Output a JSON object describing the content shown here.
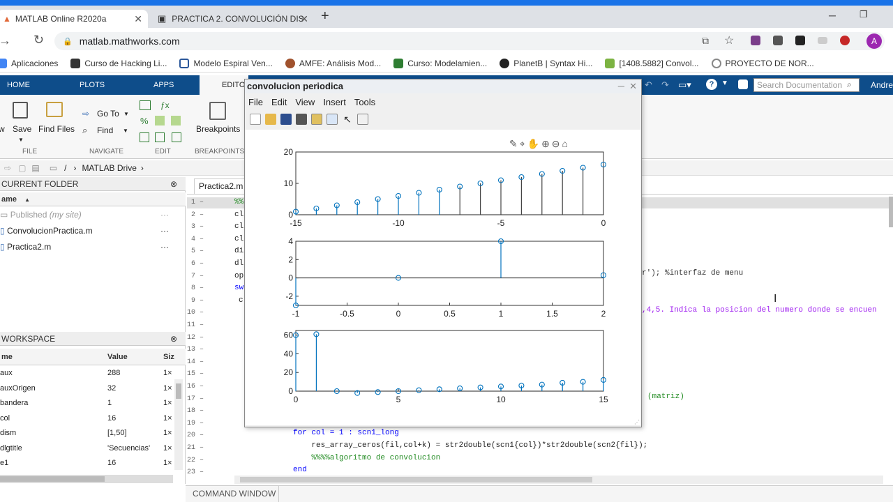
{
  "browser": {
    "tabs": [
      {
        "title": "MATLAB Online R2020a",
        "active": true
      },
      {
        "title": "PRACTICA 2. CONVOLUCIÓN DIS",
        "active": false
      }
    ],
    "new_tab": "+",
    "url": "matlab.mathworks.com",
    "profile_initial": "A",
    "bookmarks": [
      "Aplicaciones",
      "Curso de Hacking Li...",
      "Modelo Espiral Ven...",
      "AMFE: Análisis Mod...",
      "Curso: Modelamien...",
      "PlanetB | Syntax Hi...",
      "[1408.5882] Convol...",
      "PROYECTO DE NOR..."
    ]
  },
  "matlab": {
    "tabs": [
      "HOME",
      "PLOTS",
      "APPS",
      "EDITOR"
    ],
    "search_placeholder": "Search Documentation",
    "user": "Andre",
    "ribbon": {
      "new_short": "w",
      "save": "Save",
      "find_files": "Find Files",
      "goto": "Go To",
      "find": "Find",
      "breakpoints": "Breakpoints",
      "sections": [
        "FILE",
        "NAVIGATE",
        "EDIT",
        "BREAKPOINTS"
      ]
    },
    "path": [
      "/",
      "MATLAB Drive"
    ],
    "current_folder": {
      "title": "CURRENT FOLDER",
      "column": "ame",
      "items": [
        {
          "name": "Published",
          "note": "(my site)"
        },
        {
          "name": "ConvolucionPractica.m",
          "note": ""
        },
        {
          "name": "Practica2.m",
          "note": ""
        }
      ]
    },
    "workspace": {
      "title": "WORKSPACE",
      "columns": [
        "me",
        "Value",
        "Siz"
      ],
      "rows": [
        {
          "name": "aux",
          "value": "288",
          "size": "1×"
        },
        {
          "name": "auxOrigen",
          "value": "32",
          "size": "1×"
        },
        {
          "name": "bandera",
          "value": "1",
          "size": "1×"
        },
        {
          "name": "col",
          "value": "16",
          "size": "1×"
        },
        {
          "name": "dism",
          "value": "[1,50]",
          "size": "1×"
        },
        {
          "name": "dlgtitle",
          "value": "'Secuencias'",
          "size": "1×"
        },
        {
          "name": "e1",
          "value": "16",
          "size": "1×"
        }
      ]
    },
    "editor": {
      "tab": "Practica2.m",
      "line_numbers": [
        "1",
        "2",
        "3",
        "4",
        "5",
        "6",
        "7",
        "8",
        "9",
        "10",
        "11",
        "12",
        "13",
        "14",
        "15",
        "16",
        "17",
        "18",
        "19",
        "20",
        "21",
        "22",
        "23"
      ],
      "left_fragments": [
        "%%",
        "cl",
        "cl",
        "cl",
        "di",
        "dl",
        "op",
        "sw",
        "c"
      ],
      "right_fragments": [
        {
          "text": "r'); %interfaz de menu",
          "color": "#333"
        },
        {
          "text": ",4,5. Indica la posicion del numero donde se encuen",
          "color": "#a020f0"
        },
        {
          "text": "(matriz)",
          "color": "#228b22"
        }
      ],
      "bottom_code": [
        {
          "text": "for col = 1 : scn1_long",
          "color": "#0000ff"
        },
        {
          "text": "    res_array_ceros(fil,col+k) = str2double(scn1{col})*str2double(scn2{fil});",
          "color": "#222"
        },
        {
          "text": "    %%%%algoritmo de convolucion",
          "color": "#228b22"
        },
        {
          "text": "end",
          "color": "#0000ff"
        }
      ]
    },
    "command_window": "COMMAND WINDOW"
  },
  "figure": {
    "title": "convolucion periodica",
    "menu": [
      "File",
      "Edit",
      "View",
      "Insert",
      "Tools"
    ],
    "stem_color": "#0072bd"
  },
  "chart_data": [
    {
      "type": "stem",
      "xlim": [
        -15,
        0
      ],
      "ylim": [
        0,
        20
      ],
      "xticks": [
        "-15",
        "-10",
        "-5",
        "0"
      ],
      "yticks": [
        "0",
        "10",
        "20"
      ],
      "x": [
        -15,
        -14,
        -13,
        -12,
        -11,
        -10,
        -9,
        -8,
        -7,
        -6,
        -5,
        -4,
        -3,
        -2,
        -1,
        0
      ],
      "y": [
        1,
        2,
        3,
        4,
        5,
        6,
        7,
        8,
        9,
        10,
        11,
        12,
        13,
        14,
        15,
        16
      ],
      "stems_colored_until_x": -8
    },
    {
      "type": "stem",
      "xlim": [
        -1,
        2
      ],
      "ylim": [
        -3,
        4
      ],
      "xticks": [
        "-1",
        "-0.5",
        "0",
        "0.5",
        "1",
        "1.5",
        "2"
      ],
      "yticks": [
        "-2",
        "0",
        "2",
        "4"
      ],
      "x": [
        -1,
        0,
        1,
        2
      ],
      "y": [
        -3,
        0,
        4,
        0.3
      ]
    },
    {
      "type": "stem",
      "xlim": [
        0,
        15
      ],
      "ylim": [
        0,
        65
      ],
      "xticks": [
        "0",
        "5",
        "10",
        "15"
      ],
      "yticks": [
        "0",
        "20",
        "40",
        "60"
      ],
      "x": [
        0,
        1,
        2,
        3,
        4,
        5,
        6,
        7,
        8,
        9,
        10,
        11,
        12,
        13,
        14,
        15
      ],
      "y": [
        60,
        61,
        0,
        -2,
        -1,
        0,
        1,
        2,
        3,
        4,
        5,
        6,
        7,
        9,
        10,
        12
      ]
    }
  ]
}
